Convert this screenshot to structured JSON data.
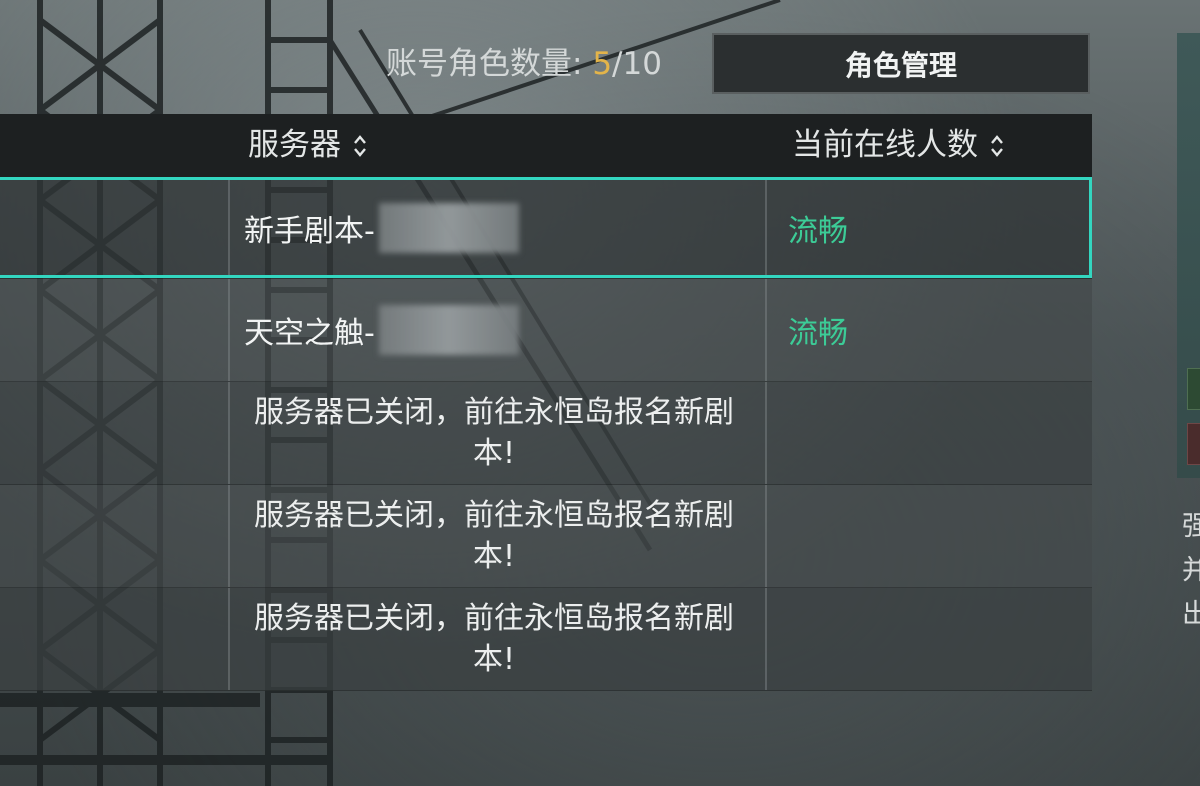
{
  "header": {
    "account_label": "账号角色数量:",
    "account_current": "5",
    "account_separator": "/",
    "account_max": "10",
    "manage_button": "角色管理"
  },
  "table": {
    "columns": [
      {
        "label": "服务器",
        "icon": "sort-updown-icon"
      },
      {
        "label": "当前在线人数",
        "icon": "sort-updown-icon"
      }
    ],
    "rows": [
      {
        "server": "新手剧本-",
        "status": "流畅",
        "selected": true
      },
      {
        "server": "天空之触-",
        "status": "流畅",
        "selected": false
      },
      {
        "message": "服务器已关闭，前往永恒岛报名新剧本!"
      },
      {
        "message": "服务器已关闭，前往永恒岛报名新剧本!"
      },
      {
        "message": "服务器已关闭，前往永恒岛报名新剧本!"
      }
    ]
  },
  "right_panel": {
    "text_lines": [
      "强",
      "并",
      "出"
    ]
  },
  "colors": {
    "accent_selected": "#33d6c0",
    "status_good": "#3ccc97",
    "count_highlight": "#e3b44a"
  }
}
